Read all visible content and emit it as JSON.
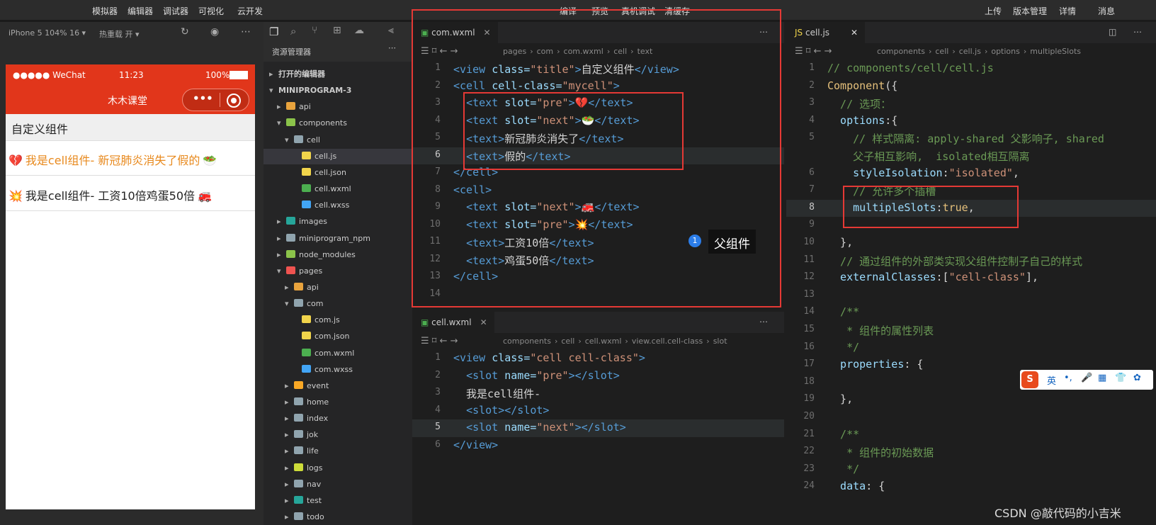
{
  "topbar": {
    "left": [
      "模拟器",
      "编辑器",
      "调试器",
      "可视化",
      "云开发"
    ],
    "center": [
      "编译",
      "预览",
      "真机调试",
      "清缓存"
    ],
    "right": [
      "上传",
      "版本管理",
      "详情",
      "消息"
    ]
  },
  "simulator": {
    "device": "iPhone 5 104% 16 ▾",
    "reload": "热重载 开 ▾",
    "status": {
      "carrier": "●●●●● WeChat",
      "time": "11:23",
      "battery": "100%"
    },
    "nav_title": "木木课堂",
    "page_title": "自定义组件",
    "rows": [
      {
        "left_emoji": "💔",
        "text": "我是cell组件- 新冠肺炎消失了假的",
        "right_emoji": "🥗",
        "color": "#e8891d"
      },
      {
        "left_emoji": "💥",
        "text": "我是cell组件- 工资10倍鸡蛋50倍",
        "right_emoji": "🚒",
        "color": "#222222"
      }
    ]
  },
  "explorer": {
    "title": "资源管理器",
    "items": [
      {
        "label": "打开的编辑器",
        "level": 0,
        "bold": true,
        "arrow": "▸"
      },
      {
        "label": "MINIPROGRAM-3",
        "level": 0,
        "bold": true,
        "arrow": "▾"
      },
      {
        "label": "api",
        "level": 1,
        "arrow": "▸",
        "icon": "folder-icon",
        "color": "#e8a33d"
      },
      {
        "label": "components",
        "level": 1,
        "arrow": "▾",
        "icon": "folder-icon",
        "color": "#8bc34a"
      },
      {
        "label": "cell",
        "level": 2,
        "arrow": "▾",
        "icon": "folder-icon",
        "color": "#90a4ae"
      },
      {
        "label": "cell.js",
        "level": 3,
        "icon": "js-file-icon",
        "color": "#f1d44b",
        "active": true
      },
      {
        "label": "cell.json",
        "level": 3,
        "icon": "json-file-icon",
        "color": "#f1d44b"
      },
      {
        "label": "cell.wxml",
        "level": 3,
        "icon": "wxml-file-icon",
        "color": "#4caf50"
      },
      {
        "label": "cell.wxss",
        "level": 3,
        "icon": "wxss-file-icon",
        "color": "#42a5f5"
      },
      {
        "label": "images",
        "level": 1,
        "arrow": "▸",
        "icon": "folder-icon",
        "color": "#26a69a"
      },
      {
        "label": "miniprogram_npm",
        "level": 1,
        "arrow": "▸",
        "icon": "folder-icon",
        "color": "#90a4ae"
      },
      {
        "label": "node_modules",
        "level": 1,
        "arrow": "▸",
        "icon": "folder-icon",
        "color": "#8bc34a"
      },
      {
        "label": "pages",
        "level": 1,
        "arrow": "▾",
        "icon": "folder-icon",
        "color": "#ef5350"
      },
      {
        "label": "api",
        "level": 2,
        "arrow": "▸",
        "icon": "folder-icon",
        "color": "#e8a33d"
      },
      {
        "label": "com",
        "level": 2,
        "arrow": "▾",
        "icon": "folder-icon",
        "color": "#90a4ae"
      },
      {
        "label": "com.js",
        "level": 3,
        "icon": "js-file-icon",
        "color": "#f1d44b"
      },
      {
        "label": "com.json",
        "level": 3,
        "icon": "json-file-icon",
        "color": "#f1d44b"
      },
      {
        "label": "com.wxml",
        "level": 3,
        "icon": "wxml-file-icon",
        "color": "#4caf50"
      },
      {
        "label": "com.wxss",
        "level": 3,
        "icon": "wxss-file-icon",
        "color": "#42a5f5"
      },
      {
        "label": "event",
        "level": 2,
        "arrow": "▸",
        "icon": "folder-icon",
        "color": "#f9a825"
      },
      {
        "label": "home",
        "level": 2,
        "arrow": "▸",
        "icon": "folder-icon",
        "color": "#90a4ae"
      },
      {
        "label": "index",
        "level": 2,
        "arrow": "▸",
        "icon": "folder-icon",
        "color": "#90a4ae"
      },
      {
        "label": "jok",
        "level": 2,
        "arrow": "▸",
        "icon": "folder-icon",
        "color": "#90a4ae"
      },
      {
        "label": "life",
        "level": 2,
        "arrow": "▸",
        "icon": "folder-icon",
        "color": "#90a4ae"
      },
      {
        "label": "logs",
        "level": 2,
        "arrow": "▸",
        "icon": "folder-icon",
        "color": "#cddc39"
      },
      {
        "label": "nav",
        "level": 2,
        "arrow": "▸",
        "icon": "folder-icon",
        "color": "#90a4ae"
      },
      {
        "label": "test",
        "level": 2,
        "arrow": "▸",
        "icon": "folder-icon",
        "color": "#26a69a"
      },
      {
        "label": "todo",
        "level": 2,
        "arrow": "▸",
        "icon": "folder-icon",
        "color": "#90a4ae"
      }
    ]
  },
  "editor1": {
    "tab": "com.wxml",
    "breadcrumb": [
      "pages",
      "com",
      "com.wxml",
      "cell",
      "text"
    ],
    "start": 1,
    "current": 6,
    "lines": [
      [
        [
          "tg",
          "<view "
        ],
        [
          "at",
          "class="
        ],
        [
          "st",
          "\"title\""
        ],
        [
          "tg",
          ">"
        ],
        [
          "pn",
          "自定义组件"
        ],
        [
          "tg",
          "</view>"
        ]
      ],
      [
        [
          "tg",
          "<cell "
        ],
        [
          "at",
          "cell-class="
        ],
        [
          "st",
          "\"mycell\""
        ],
        [
          "tg",
          ">"
        ]
      ],
      [
        [
          "pn",
          "  "
        ],
        [
          "tg",
          "<text "
        ],
        [
          "at",
          "slot="
        ],
        [
          "st",
          "\"pre\""
        ],
        [
          "tg",
          ">"
        ],
        [
          "pn",
          "💔"
        ],
        [
          "tg",
          "</text>"
        ]
      ],
      [
        [
          "pn",
          "  "
        ],
        [
          "tg",
          "<text "
        ],
        [
          "at",
          "slot="
        ],
        [
          "st",
          "\"next\""
        ],
        [
          "tg",
          ">"
        ],
        [
          "pn",
          "🥗"
        ],
        [
          "tg",
          "</text>"
        ]
      ],
      [
        [
          "pn",
          "  "
        ],
        [
          "tg",
          "<text>"
        ],
        [
          "pn",
          "新冠肺炎消失了"
        ],
        [
          "tg",
          "</text>"
        ]
      ],
      [
        [
          "pn",
          "  "
        ],
        [
          "tg",
          "<text>"
        ],
        [
          "pn",
          "假的"
        ],
        [
          "tg",
          "</text>"
        ]
      ],
      [
        [
          "tg",
          "</cell>"
        ]
      ],
      [
        [
          "tg",
          "<cell>"
        ]
      ],
      [
        [
          "pn",
          "  "
        ],
        [
          "tg",
          "<text "
        ],
        [
          "at",
          "slot="
        ],
        [
          "st",
          "\"next\""
        ],
        [
          "tg",
          ">"
        ],
        [
          "pn",
          "🚒"
        ],
        [
          "tg",
          "</text>"
        ]
      ],
      [
        [
          "pn",
          "  "
        ],
        [
          "tg",
          "<text "
        ],
        [
          "at",
          "slot="
        ],
        [
          "st",
          "\"pre\""
        ],
        [
          "tg",
          ">"
        ],
        [
          "pn",
          "💥"
        ],
        [
          "tg",
          "</text>"
        ]
      ],
      [
        [
          "pn",
          "  "
        ],
        [
          "tg",
          "<text>"
        ],
        [
          "pn",
          "工资10倍"
        ],
        [
          "tg",
          "</text>"
        ]
      ],
      [
        [
          "pn",
          "  "
        ],
        [
          "tg",
          "<text>"
        ],
        [
          "pn",
          "鸡蛋50倍"
        ],
        [
          "tg",
          "</text>"
        ]
      ],
      [
        [
          "tg",
          "</cell>"
        ]
      ],
      []
    ],
    "annotation": "父组件",
    "badge": "1"
  },
  "editor2": {
    "tab": "cell.wxml",
    "breadcrumb": [
      "components",
      "cell",
      "cell.wxml",
      "view.cell.cell-class",
      "slot"
    ],
    "start": 1,
    "current": 5,
    "lines": [
      [
        [
          "tg",
          "<view "
        ],
        [
          "at",
          "class="
        ],
        [
          "st",
          "\"cell cell-class\""
        ],
        [
          "tg",
          ">"
        ]
      ],
      [
        [
          "pn",
          "  "
        ],
        [
          "tg",
          "<slot "
        ],
        [
          "at",
          "name="
        ],
        [
          "st",
          "\"pre\""
        ],
        [
          "tg",
          "></slot>"
        ]
      ],
      [
        [
          "pn",
          "  我是cell组件-"
        ]
      ],
      [
        [
          "pn",
          "  "
        ],
        [
          "tg",
          "<slot></slot>"
        ]
      ],
      [
        [
          "pn",
          "  "
        ],
        [
          "tg",
          "<slot "
        ],
        [
          "at",
          "name="
        ],
        [
          "st",
          "\"next\""
        ],
        [
          "tg",
          "></slot>"
        ]
      ],
      [
        [
          "tg",
          "</view>"
        ]
      ]
    ]
  },
  "editor3": {
    "tab": "cell.js",
    "breadcrumb": [
      "components",
      "cell",
      "cell.js",
      "options",
      "multipleSlots"
    ],
    "current": 8,
    "numbers": [
      "1",
      "2",
      "3",
      "4",
      "5",
      "",
      "6",
      "7",
      "8",
      "9",
      "10",
      "11",
      "12",
      "13",
      "14",
      "15",
      "16",
      "17",
      "18",
      "19",
      "20",
      "21",
      "22",
      "23",
      "24"
    ],
    "lines": [
      [
        [
          "cm",
          "// components/cell/cell.js"
        ]
      ],
      [
        [
          "kw",
          "Component"
        ],
        [
          "pn",
          "({"
        ]
      ],
      [
        [
          "cm",
          "  // 选项："
        ]
      ],
      [
        [
          "at",
          "  options"
        ],
        [
          "pn",
          ":{"
        ]
      ],
      [
        [
          "cm",
          "    // 样式隔离: apply-shared 父影响子, shared"
        ]
      ],
      [
        [
          "cm",
          "    父子相互影响,  isolated相互隔离"
        ]
      ],
      [
        [
          "at",
          "    styleIsolation"
        ],
        [
          "pn",
          ":"
        ],
        [
          "st",
          "\"isolated\""
        ],
        [
          "pn",
          ","
        ]
      ],
      [
        [
          "cm",
          "    // 允许多个插槽"
        ]
      ],
      [
        [
          "at",
          "    multipleSlots"
        ],
        [
          "pn",
          ":"
        ],
        [
          "kw",
          "true"
        ],
        [
          "pn",
          ","
        ]
      ],
      [],
      [
        [
          "pn",
          "  },"
        ]
      ],
      [
        [
          "cm",
          "  // 通过组件的外部类实现父组件控制子自己的样式"
        ]
      ],
      [
        [
          "at",
          "  externalClasses"
        ],
        [
          "pn",
          ":["
        ],
        [
          "st",
          "\"cell-class\""
        ],
        [
          "pn",
          "],"
        ]
      ],
      [],
      [
        [
          "cm",
          "  /**"
        ]
      ],
      [
        [
          "cm",
          "   * 组件的属性列表"
        ]
      ],
      [
        [
          "cm",
          "   */"
        ]
      ],
      [
        [
          "at",
          "  properties"
        ],
        [
          "pn",
          ": {"
        ]
      ],
      [],
      [
        [
          "pn",
          "  },"
        ]
      ],
      [],
      [
        [
          "cm",
          "  /**"
        ]
      ],
      [
        [
          "cm",
          "   * 组件的初始数据"
        ]
      ],
      [
        [
          "cm",
          "   */"
        ]
      ],
      [
        [
          "at",
          "  data"
        ],
        [
          "pn",
          ": {"
        ]
      ]
    ]
  },
  "ime": {
    "label": "英"
  },
  "watermark": "CSDN @敲代码的小吉米"
}
